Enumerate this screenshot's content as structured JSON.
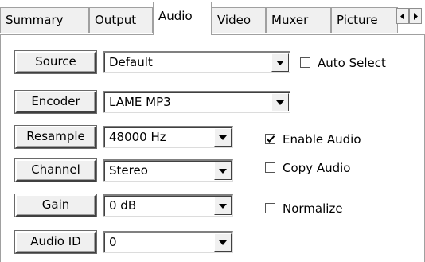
{
  "tabs": [
    "Summary",
    "Output",
    "Audio",
    "Video",
    "Muxer",
    "Picture"
  ],
  "active_tab": "Audio",
  "rows": [
    {
      "button": "Source",
      "value": "Default"
    },
    {
      "button": "Encoder",
      "value": "LAME MP3"
    },
    {
      "button": "Resample",
      "value": "48000 Hz"
    },
    {
      "button": "Channel",
      "value": "Stereo"
    },
    {
      "button": "Gain",
      "value": "0 dB"
    },
    {
      "button": "Audio ID",
      "value": "0"
    }
  ],
  "checkboxes": {
    "auto_select": {
      "label": "Auto Select",
      "checked": false
    },
    "enable_audio": {
      "label": "Enable Audio",
      "checked": true
    },
    "copy_audio": {
      "label": "Copy Audio",
      "checked": false
    },
    "normalize": {
      "label": "Normalize",
      "checked": false
    }
  },
  "icons": {
    "tab_scroll_left": "triangle-left-icon",
    "tab_scroll_right": "triangle-right-icon",
    "combo_arrow": "triangle-down-icon",
    "check_mark": "check-icon"
  }
}
